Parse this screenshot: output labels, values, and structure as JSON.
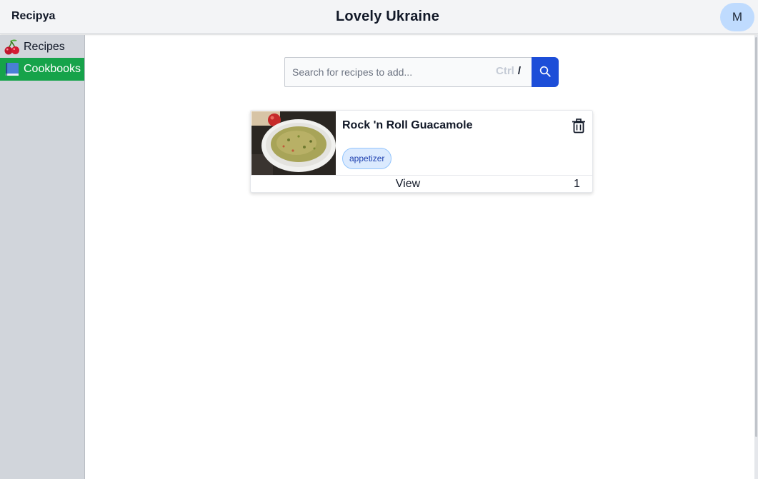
{
  "header": {
    "brand": "Recipya",
    "title": "Lovely Ukraine",
    "avatar_initial": "M"
  },
  "sidebar": {
    "items": [
      {
        "label": "Recipes",
        "icon": "cherries-icon",
        "active": false
      },
      {
        "label": "Cookbooks",
        "icon": "blue-book-icon",
        "active": true
      }
    ]
  },
  "search": {
    "placeholder": "Search for recipes to add...",
    "value": "",
    "shortcut_modifier": "Ctrl",
    "shortcut_key": "/",
    "button_icon": "search-icon"
  },
  "recipe_card": {
    "title": "Rock 'n Roll Guacamole",
    "tag": "appetizer",
    "view_label": "View",
    "index": "1",
    "delete_icon": "trash-icon",
    "image_description_icon": "guacamole-bowl-photo"
  },
  "colors": {
    "accent_green": "#16a34a",
    "search_button": "#1d4ed8",
    "avatar_bg": "#bfdbfe",
    "tag_bg": "#dbeafe"
  }
}
